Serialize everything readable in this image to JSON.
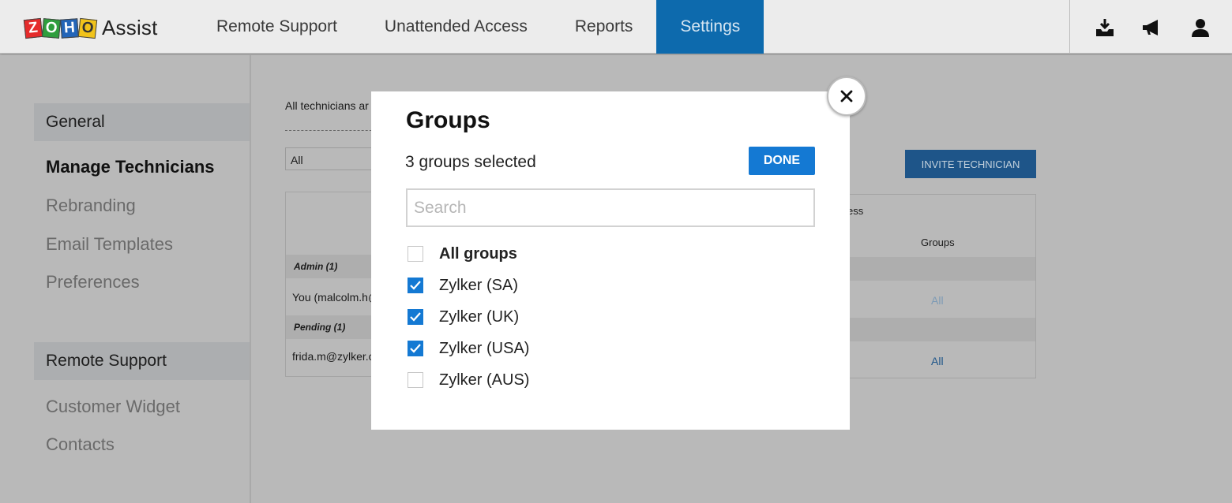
{
  "brand": {
    "logo_letters": [
      "Z",
      "O",
      "H",
      "O"
    ],
    "product": "Assist"
  },
  "nav": {
    "items": [
      {
        "label": "Remote Support",
        "active": false
      },
      {
        "label": "Unattended Access",
        "active": false
      },
      {
        "label": "Reports",
        "active": false
      },
      {
        "label": "Settings",
        "active": true
      }
    ],
    "icons": [
      "download-icon",
      "announcement-icon",
      "user-icon"
    ]
  },
  "sidebar": {
    "general_header": "General",
    "items": [
      "Manage Technicians",
      "Rebranding",
      "Email Templates",
      "Preferences"
    ],
    "remote_support_header": "Remote Support",
    "remote_items": [
      "Customer Widget",
      "Contacts"
    ]
  },
  "content": {
    "intro_text": "All technicians ar",
    "filter_value": "All",
    "invite_button": "INVITE TECHNICIAN",
    "table": {
      "col_header_partial": "ess",
      "col_groups": "Groups",
      "admin_section": "Admin (1)",
      "admin_row_email": "You (malcolm.h@",
      "admin_row_groups": "All",
      "pending_section": "Pending (1)",
      "pending_row_email": "frida.m@zylker.c",
      "pending_row_groups": "All"
    }
  },
  "modal": {
    "title": "Groups",
    "selected_count": "3 groups selected",
    "done_label": "DONE",
    "search_placeholder": "Search",
    "options": [
      {
        "label": "All groups",
        "checked": false,
        "bold": true
      },
      {
        "label": "Zylker (SA)",
        "checked": true,
        "bold": false
      },
      {
        "label": "Zylker (UK)",
        "checked": true,
        "bold": false
      },
      {
        "label": "Zylker (USA)",
        "checked": true,
        "bold": false
      },
      {
        "label": "Zylker (AUS)",
        "checked": false,
        "bold": false
      }
    ]
  },
  "colors": {
    "accent": "#1479d3",
    "nav_active": "#0d6aad",
    "overlay": "#b9b9b9"
  }
}
